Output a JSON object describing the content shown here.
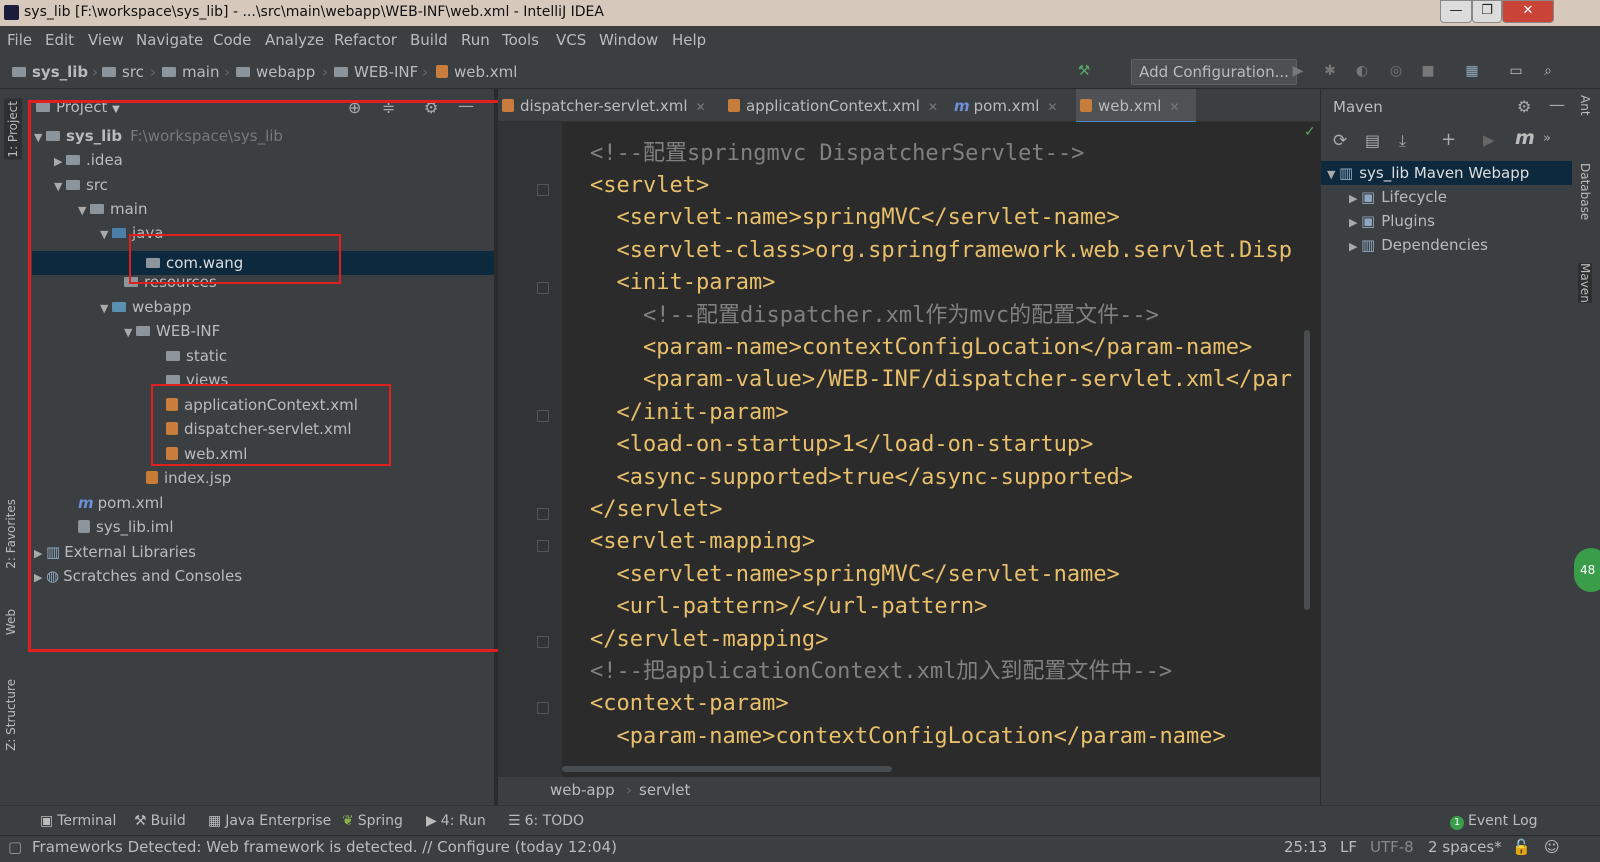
{
  "window": {
    "title": "sys_lib [F:\\workspace\\sys_lib] - ...\\src\\main\\webapp\\WEB-INF\\web.xml - IntelliJ IDEA",
    "minimize": "—",
    "maximize": "❐",
    "close": "✕"
  },
  "menu": [
    "File",
    "Edit",
    "View",
    "Navigate",
    "Code",
    "Analyze",
    "Refactor",
    "Build",
    "Run",
    "Tools",
    "VCS",
    "Window",
    "Help"
  ],
  "breadcrumbs": [
    "sys_lib",
    "src",
    "main",
    "webapp",
    "WEB-INF",
    "web.xml"
  ],
  "toolbar": {
    "add_configuration": "Add Configuration..."
  },
  "left_stripe": {
    "project": "1: Project",
    "favorites": "2: Favorites",
    "web": "Web",
    "structure": "Z: Structure"
  },
  "project": {
    "header": "Project",
    "tree": [
      {
        "label": "sys_lib",
        "hint": "F:\\workspace\\sys_lib"
      },
      {
        "label": ".idea"
      },
      {
        "label": "src"
      },
      {
        "label": "main"
      },
      {
        "label": "java"
      },
      {
        "label": "com.wang"
      },
      {
        "label": "resources"
      },
      {
        "label": "webapp"
      },
      {
        "label": "WEB-INF"
      },
      {
        "label": "static"
      },
      {
        "label": "views"
      },
      {
        "label": "applicationContext.xml"
      },
      {
        "label": "dispatcher-servlet.xml"
      },
      {
        "label": "web.xml"
      },
      {
        "label": "index.jsp"
      },
      {
        "label": "pom.xml"
      },
      {
        "label": "sys_lib.iml"
      },
      {
        "label": "External Libraries"
      },
      {
        "label": "Scratches and Consoles"
      }
    ]
  },
  "editor": {
    "tabs": [
      "dispatcher-servlet.xml",
      "applicationContext.xml",
      "pom.xml",
      "web.xml"
    ],
    "lines": [
      "<!--配置springmvc DispatcherServlet-->",
      "<servlet>",
      "  <servlet-name>springMVC</servlet-name>",
      "  <servlet-class>org.springframework.web.servlet.Disp",
      "  <init-param>",
      "    <!--配置dispatcher.xml作为mvc的配置文件-->",
      "    <param-name>contextConfigLocation</param-name>",
      "    <param-value>/WEB-INF/dispatcher-servlet.xml</par",
      "  </init-param>",
      "  <load-on-startup>1</load-on-startup>",
      "  <async-supported>true</async-supported>",
      "</servlet>",
      "<servlet-mapping>",
      "  <servlet-name>springMVC</servlet-name>",
      "  <url-pattern>/</url-pattern>",
      "</servlet-mapping>",
      "<!--把applicationContext.xml加入到配置文件中-->",
      "<context-param>",
      "  <param-name>contextConfigLocation</param-name>"
    ],
    "breadcrumb": [
      "web-app",
      "servlet"
    ]
  },
  "maven": {
    "header": "Maven",
    "root": "sys_lib Maven Webapp",
    "items": [
      "Lifecycle",
      "Plugins",
      "Dependencies"
    ]
  },
  "right_stripe": {
    "ant": "Ant",
    "database": "Database",
    "maven": "Maven"
  },
  "badge": "48",
  "bottom_tools": [
    "Terminal",
    "Build",
    "Java Enterprise",
    "Spring",
    "4: Run",
    "6: TODO",
    "Event Log"
  ],
  "event_count": "1",
  "status": {
    "message": "Frameworks Detected: Web framework is detected. // Configure (today 12:04)",
    "position": "25:13",
    "line_sep": "LF",
    "encoding": "UTF-8",
    "indent": "2 spaces*"
  }
}
